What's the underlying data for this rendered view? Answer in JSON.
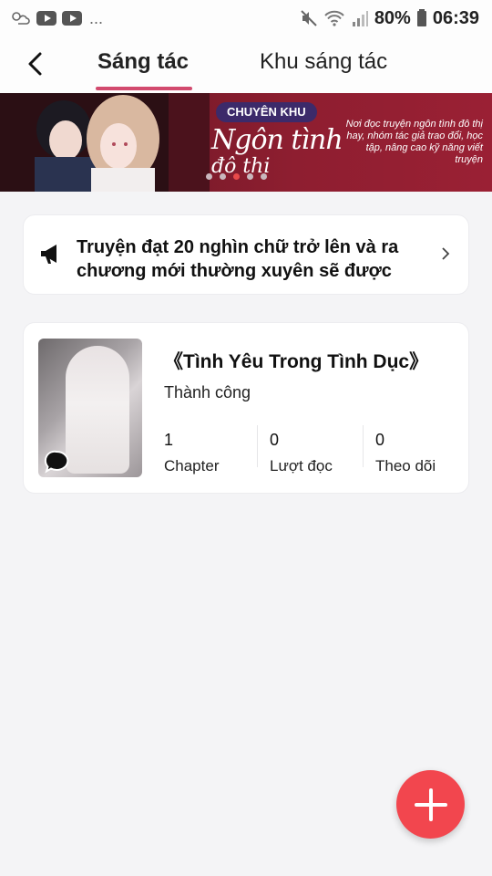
{
  "status_bar": {
    "battery": "80%",
    "time": "06:39",
    "more": "..."
  },
  "header": {
    "tabs": [
      {
        "label": "Sáng tác",
        "active": true
      },
      {
        "label": "Khu sáng tác",
        "active": false
      }
    ],
    "accent_color": "#d24a6e"
  },
  "banner": {
    "tag": "CHUYÊN KHU",
    "title": "Ngôn tình",
    "subtitle": "đô thị",
    "description": "Nơi đọc truyện ngôn tình đô thị hay, nhóm tác giả trao đổi, học tập, nâng cao kỹ năng viết truyện",
    "dots": [
      false,
      false,
      true,
      false,
      false
    ]
  },
  "notice": {
    "text": "Truyện đạt 20 nghìn chữ trở lên và ra chương mới thường xuyên sẽ được"
  },
  "story": {
    "title": "《Tình Yêu Trong Tình Dục》",
    "status": "Thành công",
    "stats": [
      {
        "value": "1",
        "label": "Chapter"
      },
      {
        "value": "0",
        "label": "Lượt đọc"
      },
      {
        "value": "0",
        "label": "Theo dõi"
      }
    ]
  },
  "fab": {
    "icon": "plus-icon",
    "color": "#f2464e"
  }
}
